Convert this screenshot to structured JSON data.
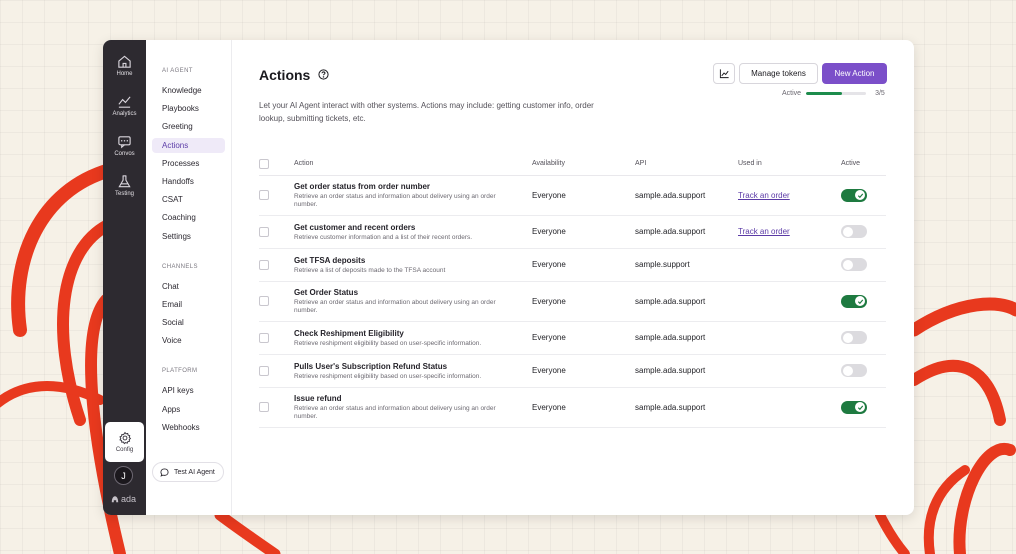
{
  "rail": {
    "items": [
      {
        "label": "Home",
        "icon": "home-icon"
      },
      {
        "label": "Analytics",
        "icon": "analytics-icon"
      },
      {
        "label": "Convos",
        "icon": "chat-icon"
      },
      {
        "label": "Testing",
        "icon": "flask-icon"
      }
    ],
    "config_label": "Config",
    "avatar_initial": "J",
    "logo_text": "ada"
  },
  "subnav": {
    "sections": [
      {
        "title": "AI AGENT",
        "items": [
          "Knowledge",
          "Playbooks",
          "Greeting",
          "Actions",
          "Processes",
          "Handoffs",
          "CSAT",
          "Coaching",
          "Settings"
        ]
      },
      {
        "title": "CHANNELS",
        "items": [
          "Chat",
          "Email",
          "Social",
          "Voice"
        ]
      },
      {
        "title": "PLATFORM",
        "items": [
          "API keys",
          "Apps",
          "Webhooks"
        ]
      }
    ],
    "active_item": "Actions",
    "test_button": "Test AI Agent"
  },
  "page": {
    "title": "Actions",
    "description": "Let your AI Agent interact with other systems. Actions may include: getting customer info, order lookup, submitting tickets, etc.",
    "manage_tokens": "Manage tokens",
    "new_action": "New Action",
    "active_label": "Active",
    "active_count": 3,
    "active_total": 5,
    "active_count_text": "3/5"
  },
  "table": {
    "headers": {
      "action": "Action",
      "availability": "Availability",
      "api": "API",
      "used_in": "Used in",
      "active": "Active"
    },
    "rows": [
      {
        "name": "Get order status from order number",
        "description": "Retrieve an order status and information about delivery using an order number.",
        "availability": "Everyone",
        "api": "sample.ada.support",
        "used_in": "Track an order",
        "active": true
      },
      {
        "name": "Get customer and recent orders",
        "description": "Retrieve customer information and a list of their recent orders.",
        "availability": "Everyone",
        "api": "sample.ada.support",
        "used_in": "Track an order",
        "active": false
      },
      {
        "name": "Get TFSA deposits",
        "description": "Retrieve a list of deposits made to the TFSA account",
        "availability": "Everyone",
        "api": "sample.support",
        "used_in": "",
        "active": false
      },
      {
        "name": "Get Order Status",
        "description": "Retrieve an order status and information about delivery using an order number.",
        "availability": "Everyone",
        "api": "sample.ada.support",
        "used_in": "",
        "active": true
      },
      {
        "name": "Check Reshipment Eligibility",
        "description": "Retrieve reshipment eligibility based on user-specific information.",
        "availability": "Everyone",
        "api": "sample.ada.support",
        "used_in": "",
        "active": false
      },
      {
        "name": "Pulls User's Subscription Refund Status",
        "description": "Retrieve reshipment eligibility based on user-specific information.",
        "availability": "Everyone",
        "api": "sample.ada.support",
        "used_in": "",
        "active": false
      },
      {
        "name": "Issue refund",
        "description": "Retrieve an order status and information about delivery using an order number.",
        "availability": "Everyone",
        "api": "sample.ada.support",
        "used_in": "",
        "active": true
      }
    ]
  },
  "colors": {
    "accent": "#7b4fc9",
    "toggle_on": "#1e7a40",
    "rail_bg": "#2d2a30",
    "background_art": "#e8391e"
  }
}
